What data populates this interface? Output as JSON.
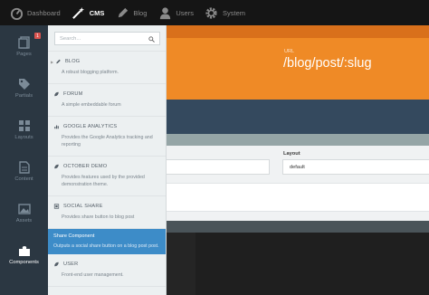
{
  "topnav": {
    "items": [
      {
        "label": "Dashboard",
        "icon": "dashboard-icon",
        "active": false
      },
      {
        "label": "CMS",
        "icon": "magic-wand-icon",
        "active": true
      },
      {
        "label": "Blog",
        "icon": "pencil-icon",
        "active": false
      },
      {
        "label": "Users",
        "icon": "user-icon",
        "active": false
      },
      {
        "label": "System",
        "icon": "gear-icon",
        "active": false
      }
    ]
  },
  "sidebar": {
    "items": [
      {
        "label": "Pages",
        "icon": "pages-icon",
        "badge": "1",
        "active": false
      },
      {
        "label": "Partials",
        "icon": "tags-icon",
        "active": false
      },
      {
        "label": "Layouts",
        "icon": "layouts-icon",
        "active": false
      },
      {
        "label": "Content",
        "icon": "content-icon",
        "active": false
      },
      {
        "label": "Assets",
        "icon": "picture-icon",
        "active": false
      },
      {
        "label": "Components",
        "icon": "puzzle-icon",
        "active": true
      }
    ]
  },
  "panel": {
    "search_placeholder": "Search...",
    "plugins": [
      {
        "name": "BLOG",
        "desc": "A robust blogging platform."
      },
      {
        "name": "FORUM",
        "desc": "A simple embeddable forum"
      },
      {
        "name": "GOOGLE ANALYTICS",
        "desc": "Provides the Google Analytics tracking and reporting"
      },
      {
        "name": "OCTOBER DEMO",
        "desc": "Provides features used by the provided demonstration theme."
      },
      {
        "name": "SOCIAL SHARE",
        "desc": "Provides share button to blog post"
      }
    ],
    "component": {
      "title": "Share Component",
      "desc": "Outputs a social share button on a blog post post."
    },
    "last_plugin": {
      "name": "USER",
      "desc": "Front-end user management."
    }
  },
  "main": {
    "url_label": "URL",
    "url_value": "/blog/post/:slug",
    "layout_label": "Layout",
    "layout_value": "default"
  },
  "colors": {
    "orange": "#ef8a26",
    "navy": "#34495e",
    "selected_blue": "#3d8cc8",
    "topbar": "#151515"
  }
}
